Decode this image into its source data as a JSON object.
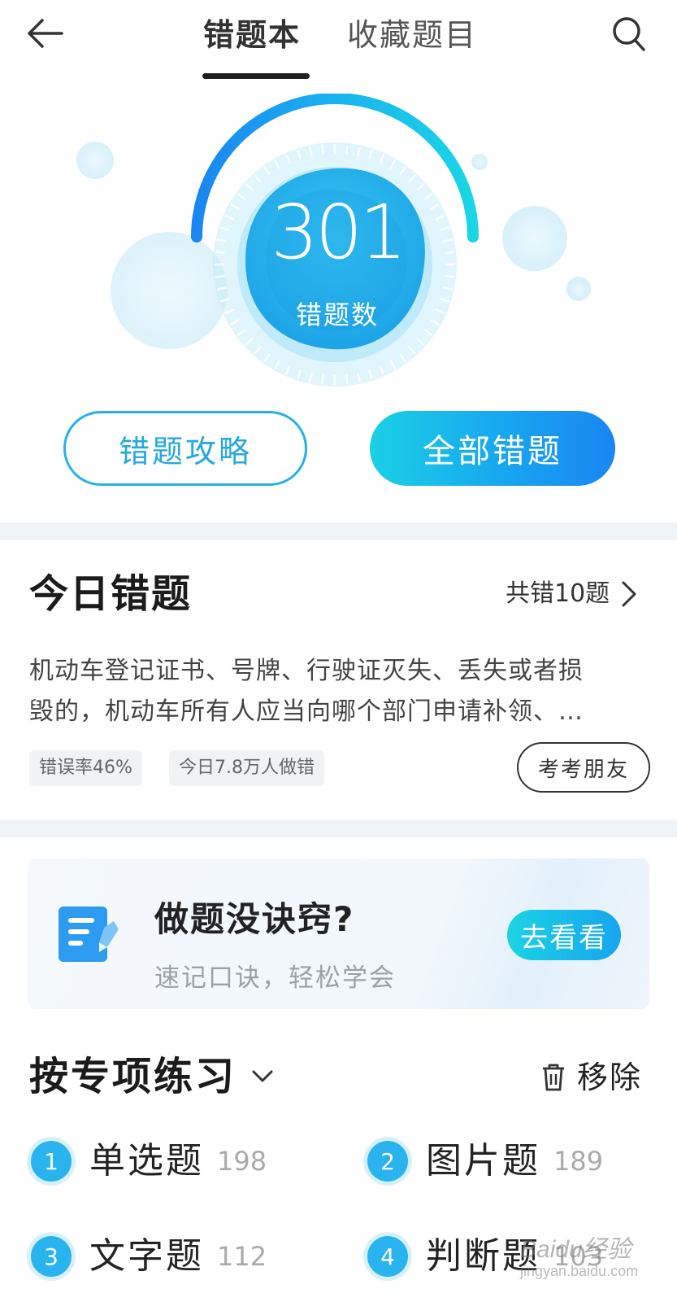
{
  "header": {
    "tabs": [
      {
        "label": "错题本",
        "active": true
      },
      {
        "label": "收藏题目",
        "active": false
      }
    ],
    "back_icon": "arrow-left-icon",
    "search_icon": "search-icon"
  },
  "gauge": {
    "count": "301",
    "label": "错题数"
  },
  "actions": {
    "strategy_label": "错题攻略",
    "all_wrong_label": "全部错题"
  },
  "today": {
    "title": "今日错题",
    "total_text": "共错10题",
    "question_line1": "机动车登记证书、号牌、行驶证灭失、丢失或者损",
    "question_line2": "毁的，机动车所有人应当向哪个部门申请补领、…",
    "error_rate": "错误率46%",
    "wrong_people": "今日7.8万人做错",
    "quiz_friends": "考考朋友"
  },
  "tip_card": {
    "title": "做题没诀窍?",
    "subtitle": "速记口诀，轻松学会",
    "button": "去看看",
    "icon": "notepad-pen-icon"
  },
  "practice": {
    "title": "按专项练习",
    "remove_label": "移除",
    "categories": [
      {
        "num": "1",
        "name": "单选题",
        "count": "198"
      },
      {
        "num": "2",
        "name": "图片题",
        "count": "189"
      },
      {
        "num": "3",
        "name": "文字题",
        "count": "112"
      },
      {
        "num": "4",
        "name": "判断题",
        "count": "103"
      }
    ]
  },
  "watermark": {
    "text": "Baidu经验",
    "url_text": "jingyan.baidu.com"
  },
  "colors": {
    "accent": "#24b2e6",
    "gradient_start": "#1bd0e6",
    "gradient_end": "#1a86f2",
    "divider": "#f1f4f6"
  }
}
